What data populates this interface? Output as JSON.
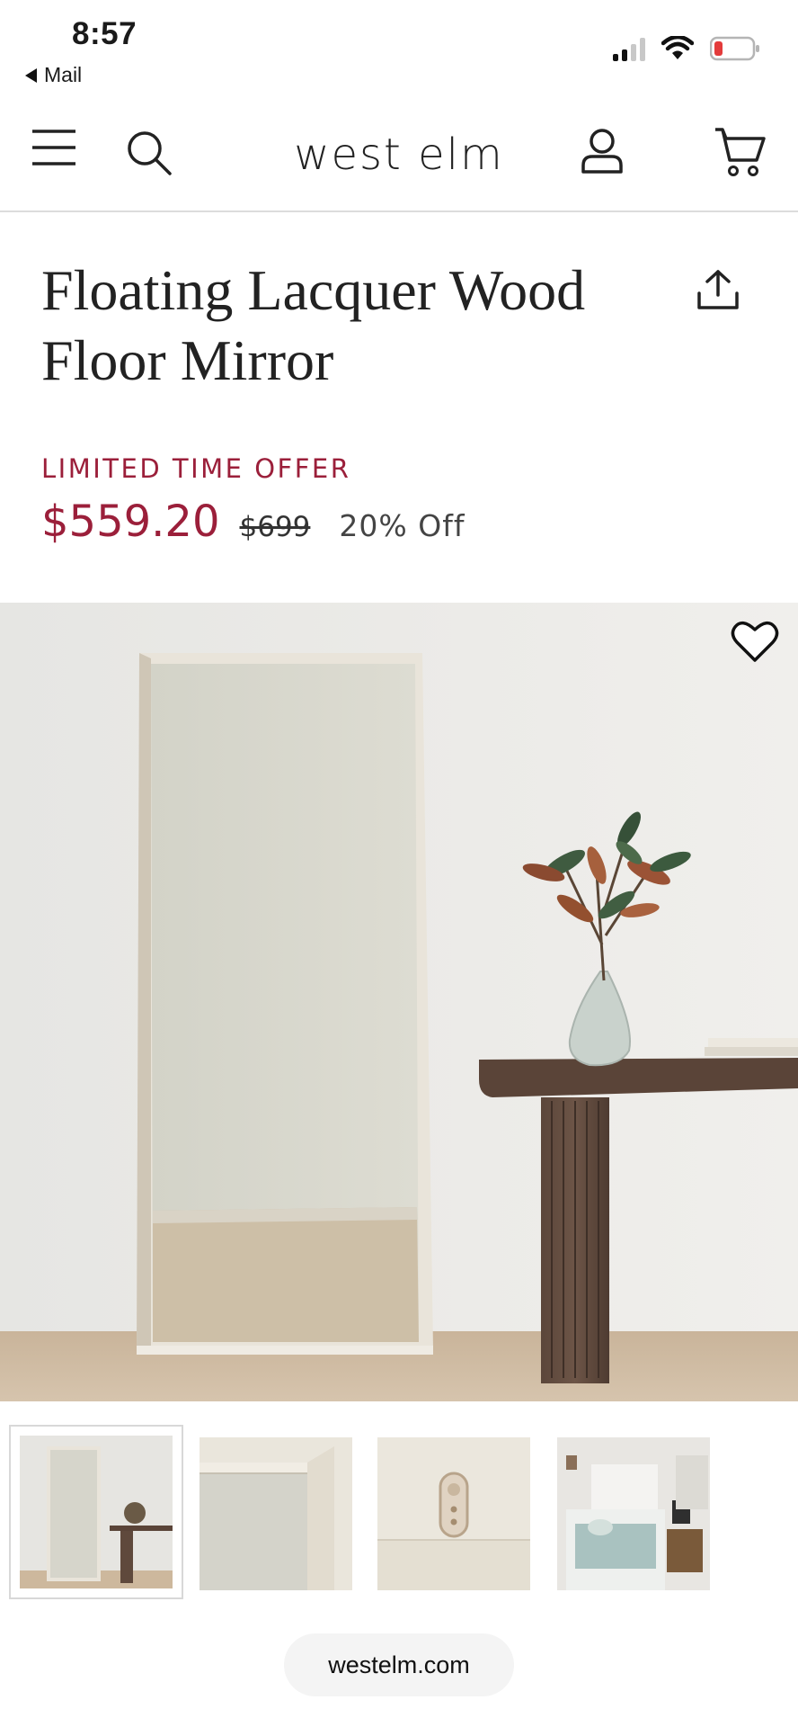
{
  "status_bar": {
    "time": "8:57",
    "back_label": "Mail"
  },
  "header": {
    "brand": "west elm",
    "icons": [
      "menu-icon",
      "search-icon",
      "account-icon",
      "cart-icon"
    ]
  },
  "product": {
    "title_line1": "Floating Lacquer Wood",
    "title_line2": "Floor Mirror",
    "promo_label": "LIMITED TIME OFFER",
    "sale_price": "$559.20",
    "original_price": "$699",
    "discount": "20% Off"
  },
  "gallery": {
    "thumbnails": [
      "mirror-with-console",
      "mirror-corner-detail",
      "mounting-hardware",
      "bedroom-scene"
    ],
    "selected_index": 0
  },
  "browser": {
    "url": "westelm.com"
  },
  "colors": {
    "accent": "#9b1f3a",
    "text": "#222222",
    "divider": "#dcdcdc"
  }
}
